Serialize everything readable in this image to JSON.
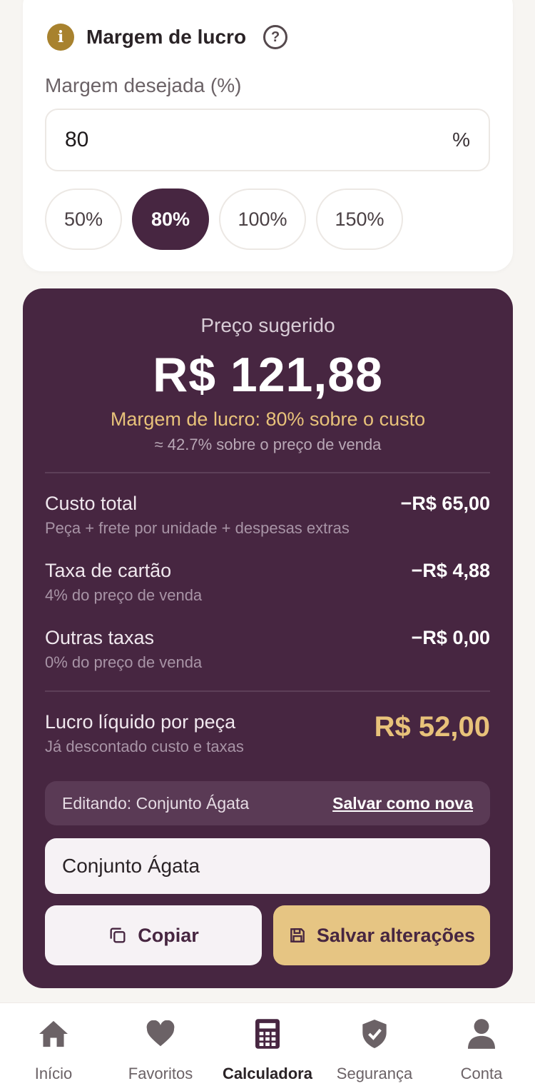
{
  "margin_card": {
    "title": "Margem de lucro",
    "info_icon": "i",
    "help_icon": "?",
    "label": "Margem desejada (%)",
    "input_value": "80",
    "input_suffix": "%",
    "chips": [
      "50%",
      "80%",
      "100%",
      "150%"
    ],
    "active_chip": "80%"
  },
  "result": {
    "suggested_label": "Preço sugerido",
    "suggested_price": "R$ 121,88",
    "margin_text": "Margem de lucro: 80% sobre o custo",
    "margin_sale_text": "≈ 42.7% sobre o preço de venda",
    "rows": [
      {
        "label": "Custo total",
        "sub": "Peça + frete por unidade + despesas extras",
        "value": "−R$ 65,00"
      },
      {
        "label": "Taxa de cartão",
        "sub": "4% do preço de venda",
        "value": "−R$ 4,88"
      },
      {
        "label": "Outras taxas",
        "sub": "0% do preço de venda",
        "value": "−R$ 0,00"
      }
    ],
    "profit": {
      "label": "Lucro líquido por peça",
      "sub": "Já descontado custo e taxas",
      "value": "R$ 52,00"
    },
    "edit_text": "Editando: Conjunto Ágata",
    "save_new_link": "Salvar como nova",
    "name_value": "Conjunto Ágata",
    "copy_button": "Copiar",
    "save_button": "Salvar alterações"
  },
  "nav": {
    "items": [
      {
        "label": "Início",
        "icon": "home-icon"
      },
      {
        "label": "Favoritos",
        "icon": "heart-icon"
      },
      {
        "label": "Calculadora",
        "icon": "calculator-icon"
      },
      {
        "label": "Segurança",
        "icon": "shield-icon"
      },
      {
        "label": "Conta",
        "icon": "user-icon"
      }
    ],
    "active": "Calculadora"
  },
  "colors": {
    "primary": "#472641",
    "accent": "#e8c27a",
    "info": "#a8822e"
  }
}
